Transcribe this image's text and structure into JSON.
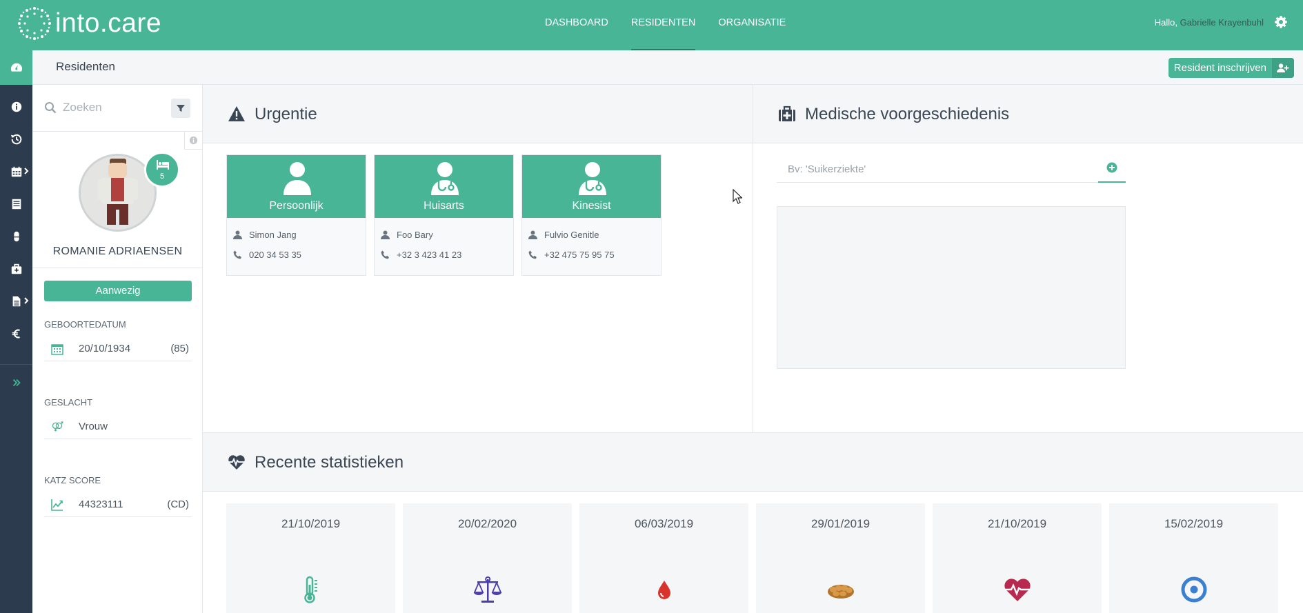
{
  "brand": {
    "name": "into.care",
    "accent": "#47b596",
    "dark": "#2c3c4e"
  },
  "nav": {
    "items": [
      "DASHBOARD",
      "RESIDENTEN",
      "ORGANISATIE"
    ],
    "active": "RESIDENTEN"
  },
  "user": {
    "greeting": "Hallo,",
    "name": "Gabrielle Krayenbuhl"
  },
  "rail": {
    "icons": [
      "dashboard-icon",
      "info-icon",
      "history-icon",
      "calendar-icon",
      "list-icon",
      "pill-icon",
      "medkit-icon",
      "document-icon",
      "euro-icon",
      "expand-icon"
    ]
  },
  "page": {
    "title": "Residenten",
    "enroll_label": "Resident inschrijven"
  },
  "search": {
    "placeholder": "Zoeken"
  },
  "resident": {
    "name": "ROMANIE ADRIAENSEN",
    "bed": "5",
    "status": "Aanwezig",
    "birthdate_label": "GEBOORTEDATUM",
    "birthdate": "20/10/1934",
    "age": "(85)",
    "gender_label": "GESLACHT",
    "gender": "Vrouw",
    "katz_label": "KATZ SCORE",
    "katz": "44323111",
    "katz_class": "(CD)"
  },
  "urgency": {
    "title": "Urgentie",
    "contacts": [
      {
        "type": "Persoonlijk",
        "name": "Simon Jang",
        "phone": "020 34 53 35"
      },
      {
        "type": "Huisarts",
        "name": "Foo Bary",
        "phone": "+32 3 423 41 23"
      },
      {
        "type": "Kinesist",
        "name": "Fulvio Genitle",
        "phone": "+32 475 75 95 75"
      }
    ]
  },
  "medical": {
    "title": "Medische voorgeschiedenis",
    "placeholder": "Bv: 'Suikerziekte'"
  },
  "stats": {
    "title": "Recente statistieken",
    "cards": [
      {
        "date": "21/10/2019",
        "icon": "thermometer-icon",
        "color": "#47b596"
      },
      {
        "date": "20/02/2020",
        "icon": "scale-icon",
        "color": "#4a3fa8"
      },
      {
        "date": "06/03/2019",
        "icon": "blood-drop-icon",
        "color": "#d9342b"
      },
      {
        "date": "29/01/2019",
        "icon": "bread-icon",
        "color": "#b3742a"
      },
      {
        "date": "21/10/2019",
        "icon": "heartbeat-icon",
        "color": "#b8294f"
      },
      {
        "date": "15/02/2019",
        "icon": "target-icon",
        "color": "#3a7fd0"
      }
    ]
  }
}
